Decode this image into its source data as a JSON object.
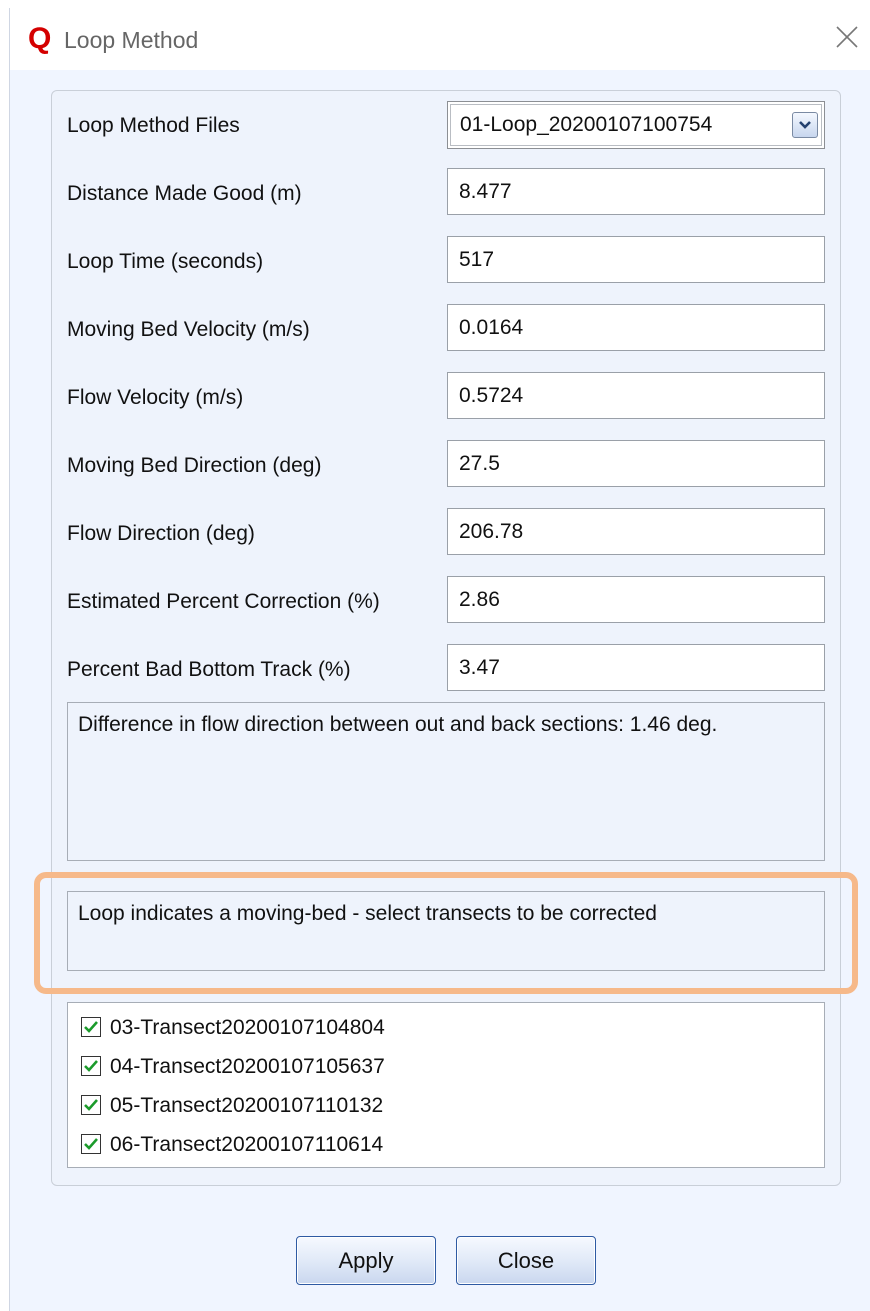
{
  "window": {
    "title": "Loop Method",
    "app_icon_letter": "Q"
  },
  "loop_files": {
    "label": "Loop Method Files",
    "selected": "01-Loop_20200107100754"
  },
  "fields": [
    {
      "label": "Distance Made Good (m)",
      "value": "8.477"
    },
    {
      "label": "Loop Time (seconds)",
      "value": "517"
    },
    {
      "label": "Moving Bed Velocity (m/s)",
      "value": "0.0164"
    },
    {
      "label": "Flow Velocity (m/s)",
      "value": "0.5724"
    },
    {
      "label": "Moving Bed Direction (deg)",
      "value": "27.5"
    },
    {
      "label": "Flow Direction (deg)",
      "value": "206.78"
    },
    {
      "label": "Estimated Percent Correction (%)",
      "value": "2.86"
    },
    {
      "label": "Percent Bad Bottom Track (%)",
      "value": "3.47"
    }
  ],
  "messages": {
    "direction_diff": "Difference in flow direction between out and back sections: 1.46 deg.",
    "moving_bed": "Loop indicates a moving-bed - select transects to be corrected"
  },
  "transects": [
    {
      "label": "03-Transect20200107104804",
      "checked": true
    },
    {
      "label": "04-Transect20200107105637",
      "checked": true
    },
    {
      "label": "05-Transect20200107110132",
      "checked": true
    },
    {
      "label": "06-Transect20200107110614",
      "checked": true
    }
  ],
  "buttons": {
    "apply": "Apply",
    "close": "Close"
  },
  "colors": {
    "highlight": "#f6b98a",
    "check": "#1b9b2b",
    "app_icon": "#d40000"
  }
}
